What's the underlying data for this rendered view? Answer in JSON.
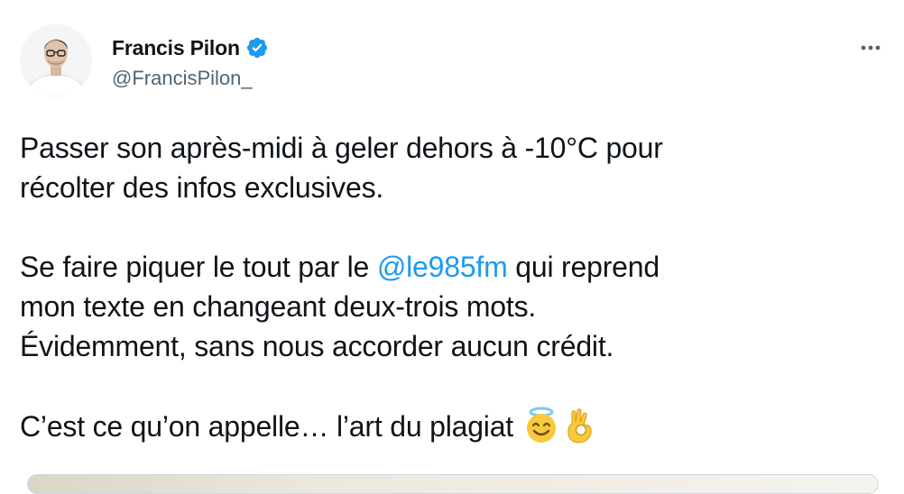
{
  "tweet": {
    "author": {
      "display_name": "Francis Pilon",
      "handle": "@FrancisPilon_",
      "verified": true,
      "verified_color": "#1d9bf0"
    },
    "more_icon": "more-horizontal-icon",
    "text": {
      "para1_line1": "Passer son après-midi à geler dehors à -10°C pour",
      "para1_line2": "récolter des infos exclusives.",
      "para2_line1_before": "Se faire piquer le tout par le ",
      "para2_mention": "@le985fm",
      "para2_line1_after": " qui reprend",
      "para2_line2": "mon texte en changeant deux-trois mots.",
      "para2_line3": "Évidemment, sans nous accorder aucun crédit.",
      "para3_line1": "C’est ce qu’on appelle… l’art du plagiat "
    },
    "emojis": [
      "smiling-face-with-halo-icon",
      "ok-hand-icon"
    ],
    "colors": {
      "text": "#0f1419",
      "secondary": "#536471",
      "link": "#1d9bf0"
    }
  }
}
